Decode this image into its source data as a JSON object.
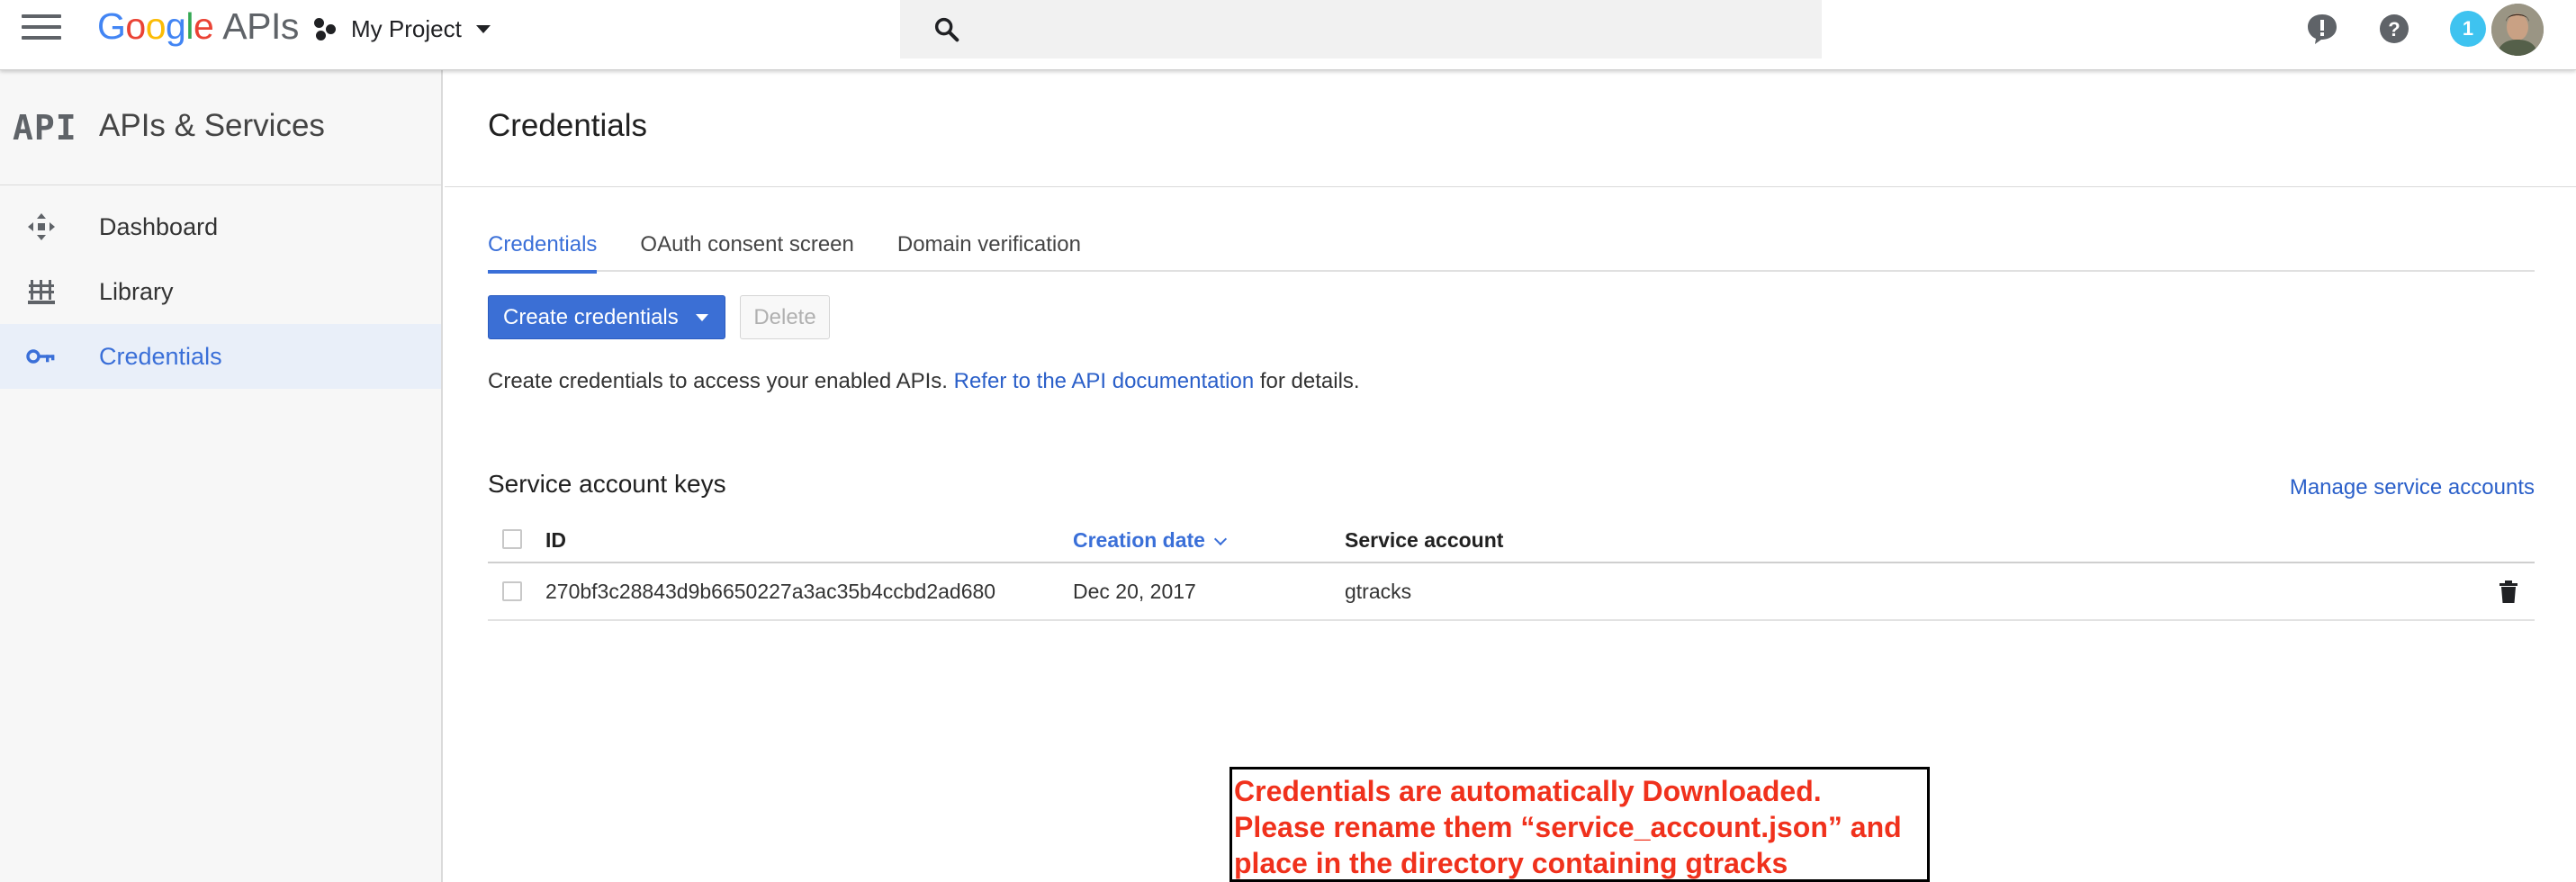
{
  "topbar": {
    "logo_google": [
      "G",
      "o",
      "o",
      "g",
      "l",
      "e"
    ],
    "logo_suffix": "APIs",
    "project_name": "My Project",
    "search_placeholder": "",
    "notification_count": "1",
    "icons": [
      "menu-icon",
      "project-icon",
      "search-icon",
      "feedback-icon",
      "help-icon",
      "notifications-icon",
      "more-vert-icon",
      "avatar"
    ]
  },
  "sidebar": {
    "title": "APIs & Services",
    "logo_text": "API",
    "items": [
      {
        "label": "Dashboard",
        "icon": "dashboard-icon",
        "active": false
      },
      {
        "label": "Library",
        "icon": "library-icon",
        "active": false
      },
      {
        "label": "Credentials",
        "icon": "key-icon",
        "active": true
      }
    ]
  },
  "main": {
    "page_title": "Credentials",
    "tabs": [
      {
        "label": "Credentials",
        "active": true
      },
      {
        "label": "OAuth consent screen",
        "active": false
      },
      {
        "label": "Domain verification",
        "active": false
      }
    ],
    "create_button": "Create credentials",
    "delete_button": "Delete",
    "info_text": "Create credentials to access your enabled APIs.",
    "info_link": "Refer to the API documentation",
    "info_suffix": "for details.",
    "section_title": "Service account keys",
    "manage_link": "Manage service accounts",
    "table": {
      "headers": [
        "ID",
        "Creation date",
        "Service account"
      ],
      "sorted_column": "Creation date",
      "rows": [
        {
          "id": "270bf3c28843d9b6650227a3ac35b4ccbd2ad680",
          "date": "Dec 20, 2017",
          "account": "gtracks"
        }
      ]
    }
  },
  "callout": {
    "lines": [
      "Credentials are automatically Downloaded.",
      "Please rename them “service_account.json” and",
      "place in the directory containing gtracks"
    ]
  },
  "colors": {
    "accent": "#3a6fd8",
    "button_primary": "#3b6fd5",
    "link": "#2a5fc9",
    "sidebar_bg": "#f7f7f7",
    "sidebar_active_bg": "#e9eff9",
    "badge": "#3ec3f0",
    "callout_text": "#f0311c"
  }
}
